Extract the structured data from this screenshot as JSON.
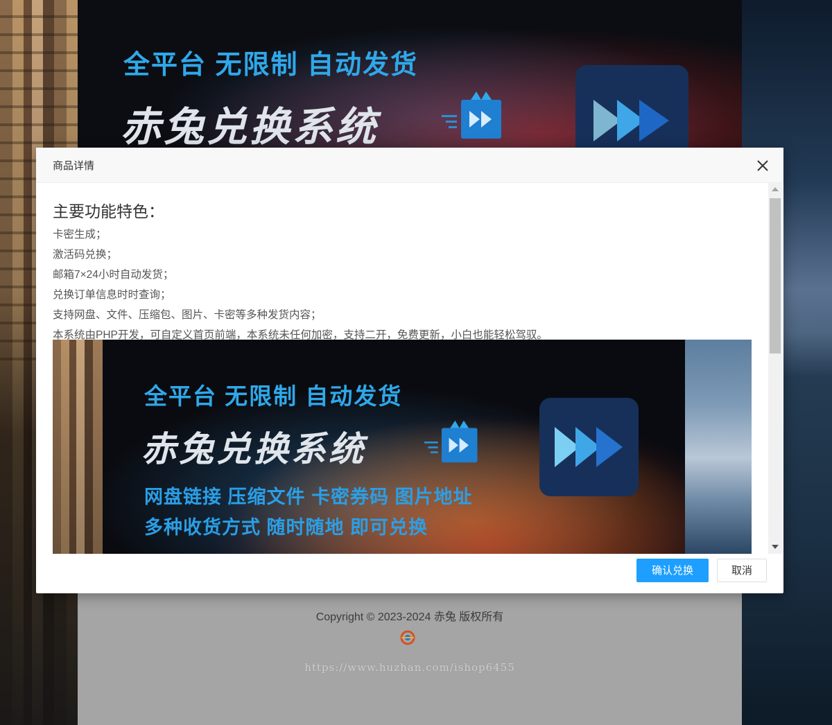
{
  "header_banner": {
    "slogan": "全平台 无限制 自动发货",
    "title": "赤兔兑换系统"
  },
  "modal": {
    "title": "商品详情",
    "close_icon": "close-icon",
    "heading": "主要功能特色：",
    "features": [
      "卡密生成；",
      "激活码兑换；",
      "邮箱7×24小时自动发货；",
      "兑换订单信息时时查询；",
      "支持网盘、文件、压缩包、图片、卡密等多种发货内容；",
      "本系统由PHP开发，可自定义首页前端，本系统未任何加密，支持二开，免费更新，小白也能轻松驾驭。"
    ],
    "image": {
      "slogan": "全平台 无限制 自动发货",
      "title": "赤兔兑换系统",
      "sub1": "网盘链接 压缩文件 卡密券码 图片地址",
      "sub2": "多种收货方式 随时随地 即可兑换"
    },
    "buttons": {
      "confirm": "确认兑换",
      "cancel": "取消"
    }
  },
  "footer": {
    "copyright": "Copyright © 2023-2024 赤兔 版权所有",
    "watermark": "https://www.huzhan.com/ishop6455"
  },
  "colors": {
    "primary": "#1e9fff",
    "accent_text": "#2fa8ea",
    "page_bg": "#a5a5a5"
  }
}
